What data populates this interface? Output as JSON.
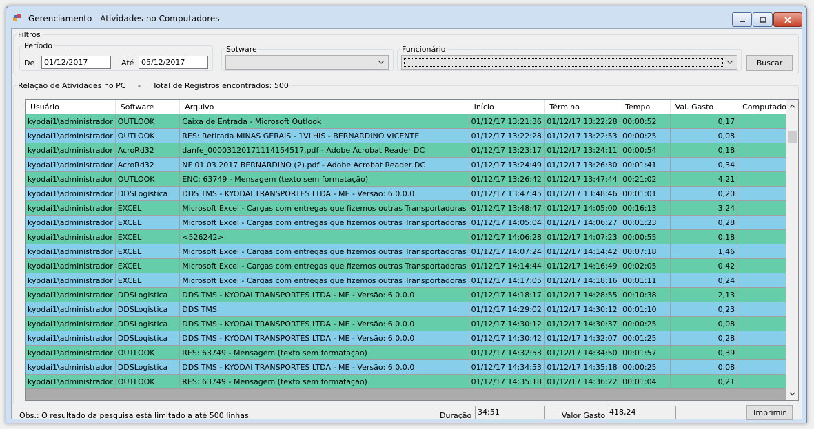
{
  "window": {
    "title": "Gerenciamento - Atividades no Computadores",
    "icon": "app-window-icon",
    "colors": {
      "green_row": "#66cdaa",
      "blue_row": "#87ceeb"
    }
  },
  "filters": {
    "group_label": "Filtros",
    "periodo": {
      "label": "Período",
      "de_label": "De",
      "de_value": "01/12/2017",
      "ate_label": "Até",
      "ate_value": "05/12/2017"
    },
    "software": {
      "label": "Sotware",
      "value": ""
    },
    "funcionario": {
      "label": "Funcionário",
      "value": ""
    },
    "search_button": "Buscar"
  },
  "results": {
    "label": "Relação de Atividades no PC",
    "separator": "-",
    "count_text": "Total de Registros encontrados: 500"
  },
  "table": {
    "headers": [
      "Usuário",
      "Software",
      "Arquivo",
      "Início",
      "Término",
      "Tempo",
      "Val. Gasto",
      "Computador"
    ],
    "rows": [
      {
        "usuario": "kyodai1\\administrador",
        "software": "OUTLOOK",
        "arquivo": "Caixa de Entrada - Microsoft Outlook",
        "inicio": "01/12/17 13:21:36",
        "termino": "01/12/17 13:22:28",
        "tempo": "00:00:52",
        "valor": "0,17",
        "computador": ""
      },
      {
        "usuario": "kyodai1\\administrador",
        "software": "OUTLOOK",
        "arquivo": "RES: Retirada MINAS GERAIS - 1VLHIS - BERNARDINO VICENTE",
        "inicio": "01/12/17 13:22:28",
        "termino": "01/12/17 13:22:53",
        "tempo": "00:00:25",
        "valor": "0,08",
        "computador": ""
      },
      {
        "usuario": "kyodai1\\administrador",
        "software": "AcroRd32",
        "arquivo": "danfe_00003120171114154517.pdf - Adobe Acrobat Reader DC",
        "inicio": "01/12/17 13:23:17",
        "termino": "01/12/17 13:24:11",
        "tempo": "00:00:54",
        "valor": "0,18",
        "computador": ""
      },
      {
        "usuario": "kyodai1\\administrador",
        "software": "AcroRd32",
        "arquivo": "NF 01 03 2017 BERNARDINO (2).pdf - Adobe Acrobat Reader DC",
        "inicio": "01/12/17 13:24:49",
        "termino": "01/12/17 13:26:30",
        "tempo": "00:01:41",
        "valor": "0,34",
        "computador": ""
      },
      {
        "usuario": "kyodai1\\administrador",
        "software": "OUTLOOK",
        "arquivo": "ENC: 63749 - Mensagem (texto sem formatação)",
        "inicio": "01/12/17 13:26:42",
        "termino": "01/12/17 13:47:44",
        "tempo": "00:21:02",
        "valor": "4,21",
        "computador": ""
      },
      {
        "usuario": "kyodai1\\administrador",
        "software": "DDSLogistica",
        "arquivo": "DDS TMS - KYODAI TRANSPORTES LTDA - ME - Versão: 6.0.0.0",
        "inicio": "01/12/17 13:47:45",
        "termino": "01/12/17 13:48:46",
        "tempo": "00:01:01",
        "valor": "0,20",
        "computador": ""
      },
      {
        "usuario": "kyodai1\\administrador",
        "software": "EXCEL",
        "arquivo": "Microsoft Excel - Cargas com entregas que fizemos outras Transportadoras",
        "inicio": "01/12/17 13:48:47",
        "termino": "01/12/17 14:05:00",
        "tempo": "00:16:13",
        "valor": "3,24",
        "computador": ""
      },
      {
        "usuario": "kyodai1\\administrador",
        "software": "EXCEL",
        "arquivo": "Microsoft Excel - Cargas com entregas que fizemos outras Transportadoras",
        "inicio": "01/12/17 14:05:04",
        "termino": "01/12/17 14:06:27",
        "tempo": "00:01:23",
        "valor": "0,28",
        "computador": ""
      },
      {
        "usuario": "kyodai1\\administrador",
        "software": "EXCEL",
        "arquivo": "<526242>",
        "inicio": "01/12/17 14:06:28",
        "termino": "01/12/17 14:07:23",
        "tempo": "00:00:55",
        "valor": "0,18",
        "computador": ""
      },
      {
        "usuario": "kyodai1\\administrador",
        "software": "EXCEL",
        "arquivo": "Microsoft Excel - Cargas com entregas que fizemos outras Transportadoras",
        "inicio": "01/12/17 14:07:24",
        "termino": "01/12/17 14:14:42",
        "tempo": "00:07:18",
        "valor": "1,46",
        "computador": ""
      },
      {
        "usuario": "kyodai1\\administrador",
        "software": "EXCEL",
        "arquivo": "Microsoft Excel - Cargas com entregas que fizemos outras Transportadoras",
        "inicio": "01/12/17 14:14:44",
        "termino": "01/12/17 14:16:49",
        "tempo": "00:02:05",
        "valor": "0,42",
        "computador": ""
      },
      {
        "usuario": "kyodai1\\administrador",
        "software": "EXCEL",
        "arquivo": "Microsoft Excel - Cargas com entregas que fizemos outras Transportadoras",
        "inicio": "01/12/17 14:17:05",
        "termino": "01/12/17 14:18:16",
        "tempo": "00:01:11",
        "valor": "0,24",
        "computador": ""
      },
      {
        "usuario": "kyodai1\\administrador",
        "software": "DDSLogistica",
        "arquivo": "DDS TMS - KYODAI TRANSPORTES LTDA - ME - Versão: 6.0.0.0",
        "inicio": "01/12/17 14:18:17",
        "termino": "01/12/17 14:28:55",
        "tempo": "00:10:38",
        "valor": "2,13",
        "computador": ""
      },
      {
        "usuario": "kyodai1\\administrador",
        "software": "DDSLogistica",
        "arquivo": "DDS TMS",
        "inicio": "01/12/17 14:29:02",
        "termino": "01/12/17 14:30:12",
        "tempo": "00:01:10",
        "valor": "0,23",
        "computador": ""
      },
      {
        "usuario": "kyodai1\\administrador",
        "software": "DDSLogistica",
        "arquivo": "DDS TMS - KYODAI TRANSPORTES LTDA - ME - Versão: 6.0.0.0",
        "inicio": "01/12/17 14:30:12",
        "termino": "01/12/17 14:30:37",
        "tempo": "00:00:25",
        "valor": "0,08",
        "computador": ""
      },
      {
        "usuario": "kyodai1\\administrador",
        "software": "DDSLogistica",
        "arquivo": "DDS TMS - KYODAI TRANSPORTES LTDA - ME - Versão: 6.0.0.0",
        "inicio": "01/12/17 14:30:42",
        "termino": "01/12/17 14:32:07",
        "tempo": "00:01:25",
        "valor": "0,28",
        "computador": ""
      },
      {
        "usuario": "kyodai1\\administrador",
        "software": "OUTLOOK",
        "arquivo": "RES: 63749 - Mensagem (texto sem formatação)",
        "inicio": "01/12/17 14:32:53",
        "termino": "01/12/17 14:34:50",
        "tempo": "00:01:57",
        "valor": "0,39",
        "computador": ""
      },
      {
        "usuario": "kyodai1\\administrador",
        "software": "DDSLogistica",
        "arquivo": "DDS TMS - KYODAI TRANSPORTES LTDA - ME - Versão: 6.0.0.0",
        "inicio": "01/12/17 14:34:53",
        "termino": "01/12/17 14:35:18",
        "tempo": "00:00:25",
        "valor": "0,08",
        "computador": ""
      },
      {
        "usuario": "kyodai1\\administrador",
        "software": "OUTLOOK",
        "arquivo": "RES: 63749 - Mensagem (texto sem formatação)",
        "inicio": "01/12/17 14:35:18",
        "termino": "01/12/17 14:36:22",
        "tempo": "00:01:04",
        "valor": "0,21",
        "computador": ""
      }
    ]
  },
  "footer": {
    "obs": "Obs.: O resultado da pesquisa está limitado a até 500 linhas",
    "duracao_label": "Duração",
    "duracao_value": "34:51",
    "valor_label": "Valor Gasto",
    "valor_value": "418,24",
    "print_button": "Imprimir"
  }
}
